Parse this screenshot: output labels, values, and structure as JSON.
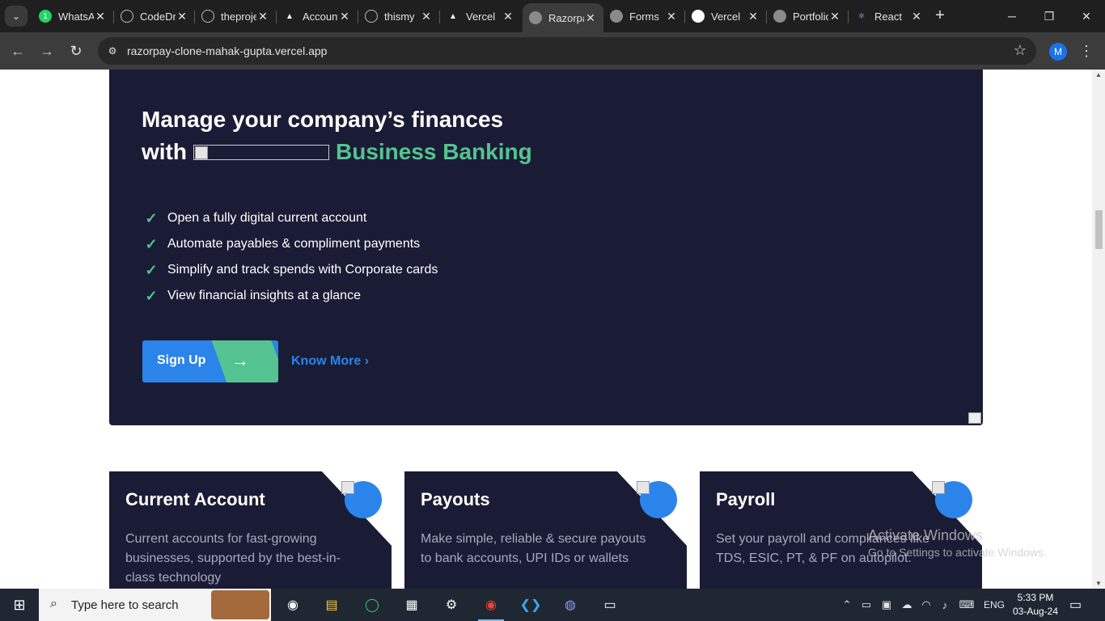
{
  "browser": {
    "tabs": [
      {
        "title": "WhatsApp",
        "favicon": "whatsapp-icon",
        "badge": "1"
      },
      {
        "title": "CodeDrill",
        "favicon": "github-icon"
      },
      {
        "title": "theprojects",
        "favicon": "github-icon"
      },
      {
        "title": "Account",
        "favicon": "vercel-icon"
      },
      {
        "title": "thismy",
        "favicon": "github-icon"
      },
      {
        "title": "Vercel",
        "favicon": "vercel-icon"
      },
      {
        "title": "Razorpay",
        "favicon": "globe-icon",
        "active": true
      },
      {
        "title": "Forms",
        "favicon": "globe-icon"
      },
      {
        "title": "Vercel",
        "favicon": "chatgpt-icon"
      },
      {
        "title": "Portfolio",
        "favicon": "globe-icon"
      },
      {
        "title": "React",
        "favicon": "react-icon"
      }
    ],
    "url": "razorpay-clone-mahak-gupta.vercel.app",
    "profile_initial": "M"
  },
  "hero": {
    "title_line1": "Manage your company’s finances",
    "title_with": "with",
    "title_accent": "Business Banking",
    "features": [
      "Open a fully digital current account",
      "Automate payables & compliment payments",
      "Simplify and track spends with Corporate cards",
      "View financial insights at a glance"
    ],
    "signup_label": "Sign Up",
    "know_more_label": "Know More",
    "accent_color": "#55c391",
    "primary_color": "#2b84ea",
    "background_color": "#1a1c35"
  },
  "cards": [
    {
      "title": "Current Account",
      "description": "Current accounts for fast-growing businesses, supported by the best-in-class technology"
    },
    {
      "title": "Payouts",
      "description": "Make simple, reliable & secure payouts to bank accounts, UPI IDs or wallets"
    },
    {
      "title": "Payroll",
      "description": "Set your payroll and compliances like TDS, ESIC, PT, & PF on autopilot."
    }
  ],
  "watermark": {
    "line1": "Activate Windows",
    "line2": "Go to Settings to activate Windows."
  },
  "taskbar": {
    "search_placeholder": "Type here to search",
    "language": "ENG",
    "time": "5:33 PM",
    "date": "03-Aug-24"
  }
}
